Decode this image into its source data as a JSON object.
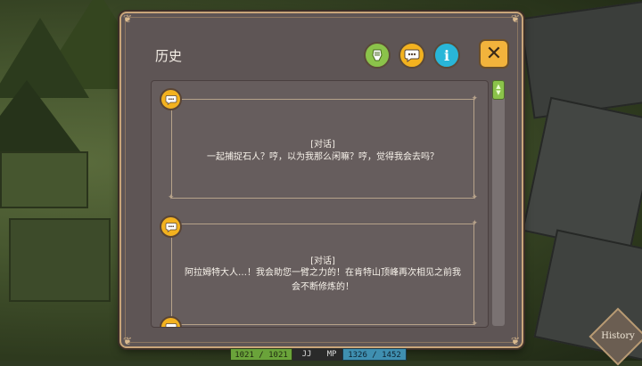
{
  "window": {
    "title": "历史"
  },
  "header_buttons": {
    "filter_icon": "hand-filter-icon",
    "talk_icon": "speech-bubble-icon",
    "info_icon": "info-icon",
    "info_glyph": "i",
    "close_glyph": "✕"
  },
  "entries": [
    {
      "icon": "speech-bubble-icon",
      "tag": "[对话]",
      "lines": [
        "一起捕捉石人？哼，以为我那么闲嘛？哼，觉得我会去吗？"
      ]
    },
    {
      "icon": "speech-bubble-icon",
      "tag": "[对话]",
      "lines": [
        "阿拉姆特大人…！我会助您一臂之力的！在肯特山顶峰再次相见之前我",
        "会不断修炼的！"
      ]
    }
  ],
  "hud": {
    "hp": "1021 / 1021",
    "mid": "JJ",
    "mp_label": "MP",
    "mp": "1326 / 1452"
  },
  "history_button": {
    "label": "History"
  },
  "colors": {
    "accent": "#f3b21f",
    "frame": "#c9a57a",
    "panel": "#5e5555",
    "filter_green": "#8bc34a",
    "info_blue": "#29b6d8"
  }
}
